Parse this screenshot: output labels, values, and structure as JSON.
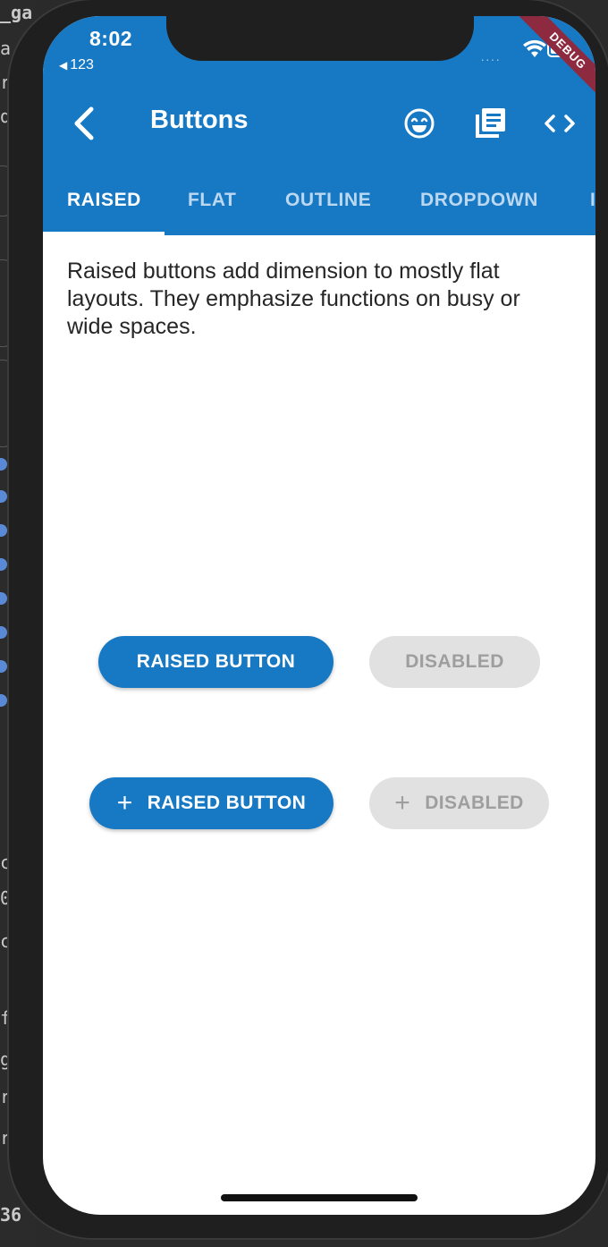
{
  "status_bar": {
    "time": "8:02",
    "back_app": "123",
    "debug_banner": "DEBUG"
  },
  "appbar": {
    "title": "Buttons",
    "back_icon": "chevron-left-icon",
    "actions": [
      "smiley-icon",
      "library-books-icon",
      "code-icon"
    ],
    "background": "#1779c3"
  },
  "tabs": [
    {
      "label": "RAISED",
      "active": true
    },
    {
      "label": "FLAT",
      "active": false
    },
    {
      "label": "OUTLINE",
      "active": false
    },
    {
      "label": "DROPDOWN",
      "active": false
    },
    {
      "label": "I",
      "active": false
    }
  ],
  "description": "Raised buttons add dimension to mostly flat layouts. They emphasize functions on busy or wide spaces.",
  "buttons": {
    "raised_label": "RAISED BUTTON",
    "disabled_label": "DISABLED",
    "raised_icon_label": "RAISED BUTTON",
    "disabled_icon_label": "DISABLED",
    "icon": "plus-icon"
  },
  "colors": {
    "primary": "#1779c3",
    "disabled_bg": "#e1e1e1",
    "disabled_text": "#9e9e9e"
  },
  "background_ide": {
    "glyphs": [
      "_ga",
      "a",
      "r",
      "d",
      "c",
      "0",
      "c",
      "f",
      "g",
      "r",
      "r",
      "36"
    ]
  }
}
